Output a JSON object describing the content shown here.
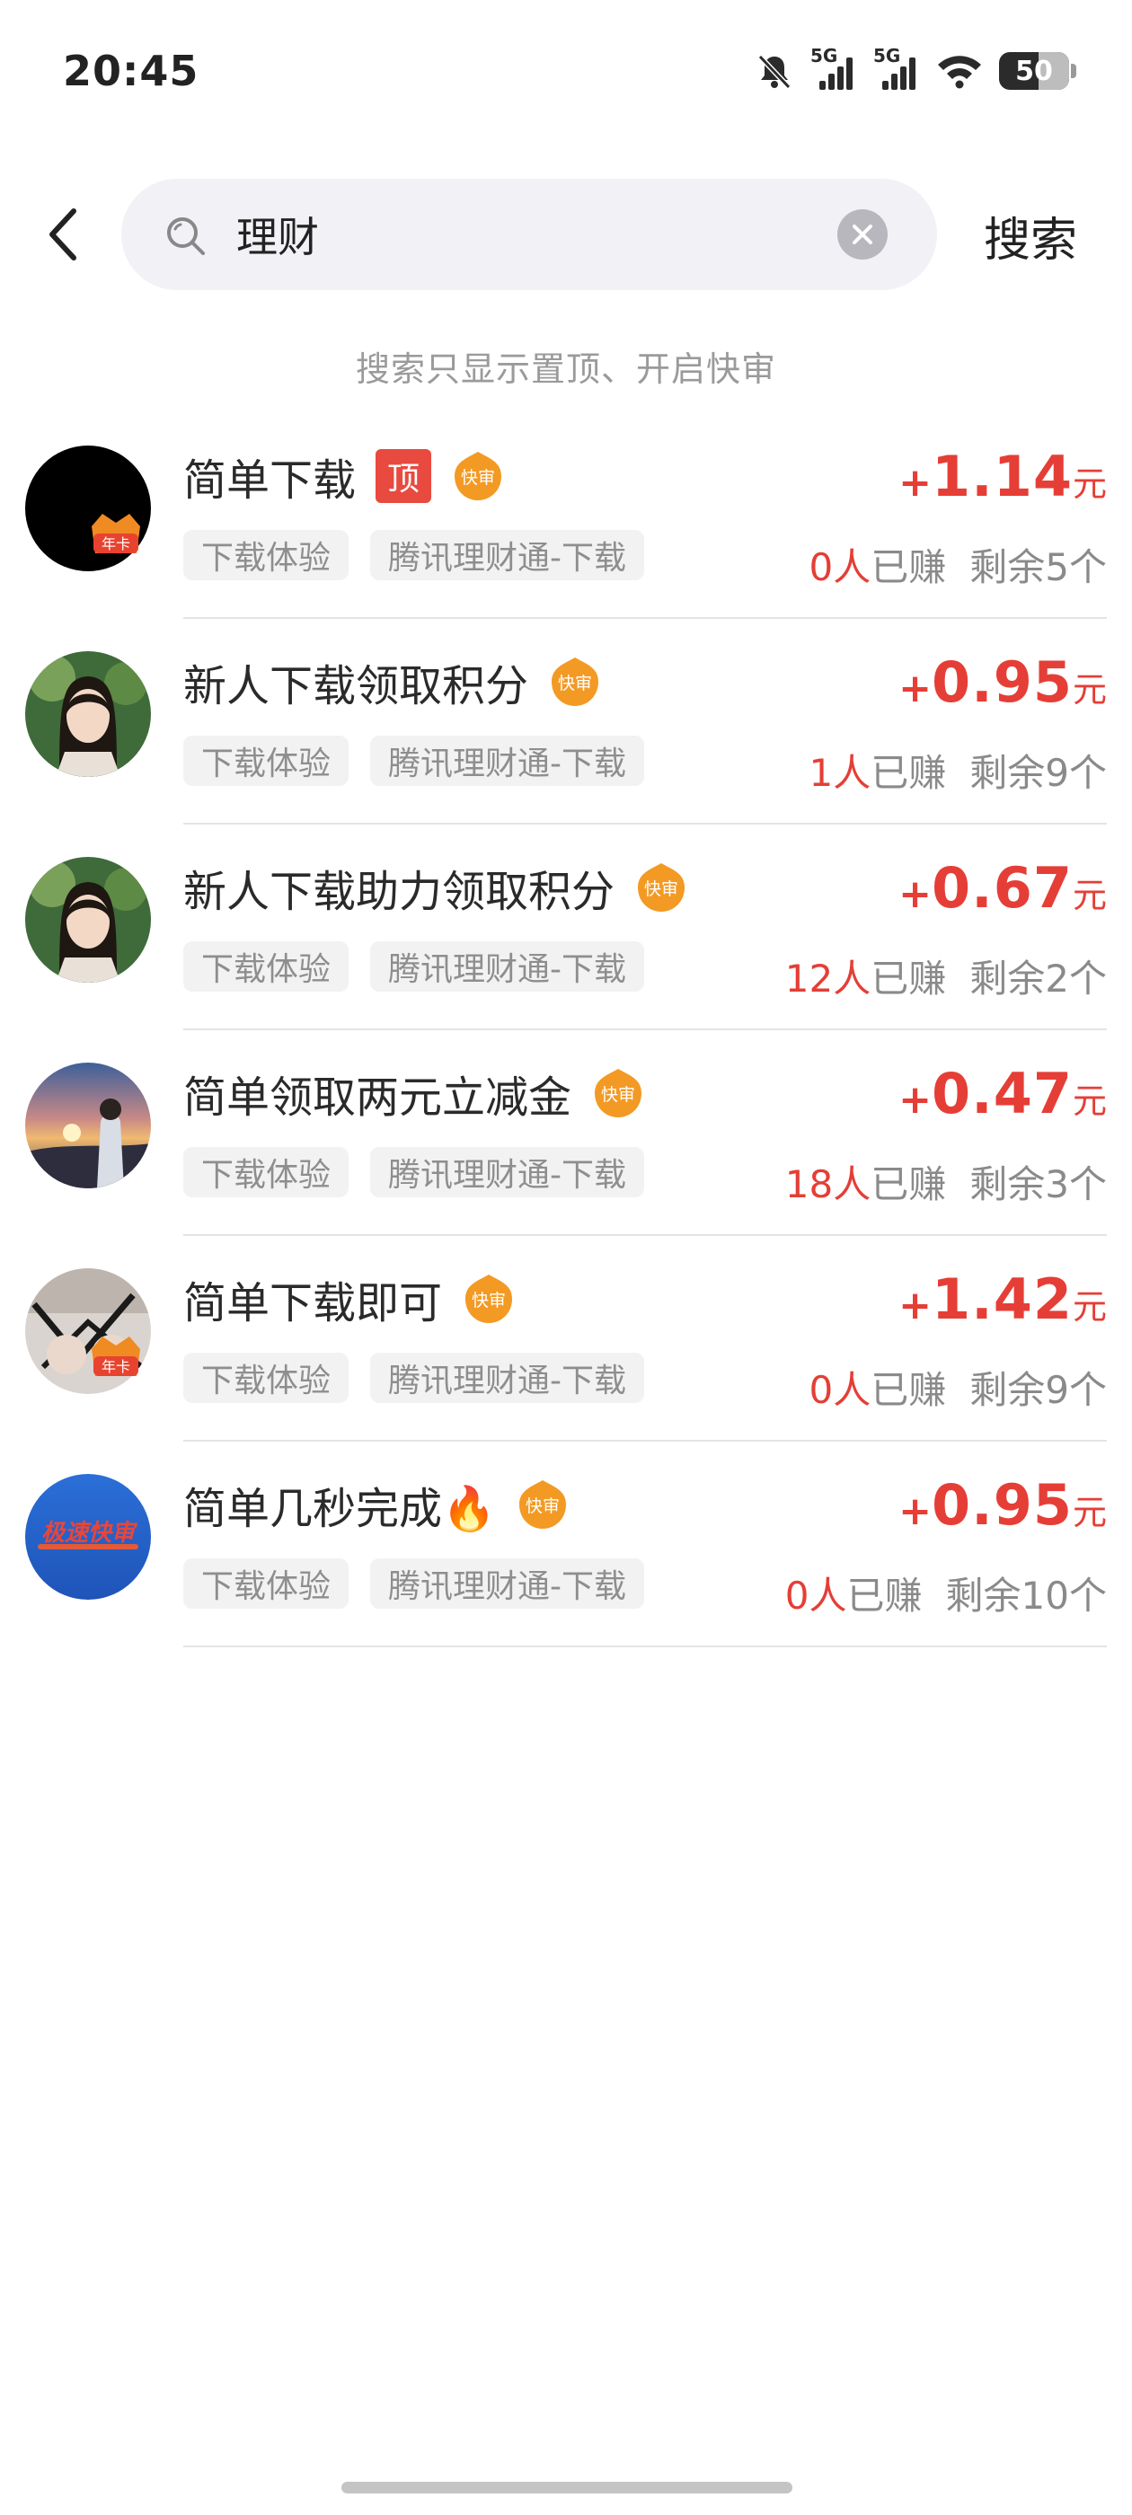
{
  "status_bar": {
    "time": "20:45",
    "network_1": "5G",
    "network_2": "5G",
    "battery": "50"
  },
  "search": {
    "query": "理财",
    "search_button": "搜索"
  },
  "hint": "搜索只显示置顶、开启快审",
  "labels": {
    "top_tag": "顶",
    "fast_tag": "快审",
    "year_badge": "年卡",
    "earned_suffix": "已赚",
    "avatar_brand_text": "极速快审"
  },
  "tasks": [
    {
      "title": "简单下载",
      "tags": [
        "下载体验",
        "腾讯理财通-下载"
      ],
      "reward_plus": "+",
      "reward": "1.14",
      "unit": "元",
      "earned": "0人",
      "remaining": "剩余5个"
    },
    {
      "title": "新人下载领取积分",
      "tags": [
        "下载体验",
        "腾讯理财通-下载"
      ],
      "reward_plus": "+",
      "reward": "0.95",
      "unit": "元",
      "earned": "1人",
      "remaining": "剩余9个"
    },
    {
      "title": "新人下载助力领取积分",
      "tags": [
        "下载体验",
        "腾讯理财通-下载"
      ],
      "reward_plus": "+",
      "reward": "0.67",
      "unit": "元",
      "earned": "12人",
      "remaining": "剩余2个"
    },
    {
      "title": "简单领取两元立减金",
      "tags": [
        "下载体验",
        "腾讯理财通-下载"
      ],
      "reward_plus": "+",
      "reward": "0.47",
      "unit": "元",
      "earned": "18人",
      "remaining": "剩余3个"
    },
    {
      "title": "简单下载即可",
      "tags": [
        "下载体验",
        "腾讯理财通-下载"
      ],
      "reward_plus": "+",
      "reward": "1.42",
      "unit": "元",
      "earned": "0人",
      "remaining": "剩余9个"
    },
    {
      "title": "简单几秒完成🔥",
      "tags": [
        "下载体验",
        "腾讯理财通-下载"
      ],
      "reward_plus": "+",
      "reward": "0.95",
      "unit": "元",
      "earned": "0人",
      "remaining": "剩余10个"
    }
  ],
  "colors": {
    "accent_red": "#e53e36",
    "top_tag": "#e84a3f",
    "fast_tag": "#f39a24",
    "search_bg": "#f1f1f6"
  }
}
